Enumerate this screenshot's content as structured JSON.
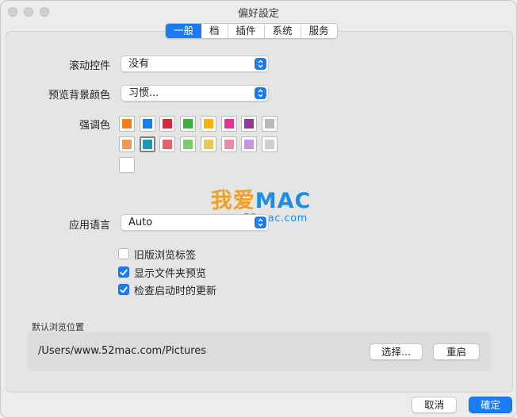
{
  "window": {
    "title": "偏好設定"
  },
  "tabs": [
    {
      "label": "一般",
      "active": true
    },
    {
      "label": "档",
      "active": false
    },
    {
      "label": "插件",
      "active": false
    },
    {
      "label": "系统",
      "active": false
    },
    {
      "label": "服务",
      "active": false
    }
  ],
  "scroll": {
    "label": "滚动控件",
    "value": "没有"
  },
  "preview_bg": {
    "label": "预览背景颜色",
    "value": "习惯..."
  },
  "accent": {
    "label": "强调色",
    "row1": [
      "#f57d0f",
      "#1a7cf3",
      "#d8283f",
      "#3faf3a",
      "#f5b50a",
      "#e8328f",
      "#8e3a96",
      "#b8b8b8"
    ],
    "row2": [
      "#ec9a55",
      "#1a9ab0",
      "#e4606e",
      "#7ccb6c",
      "#e6c85a",
      "#e88aa8",
      "#c495e2",
      "#cfcfcf"
    ],
    "row3": [
      "#ffffff"
    ],
    "selected_index": 9
  },
  "language": {
    "label": "应用语言",
    "value": "Auto"
  },
  "watermark": {
    "big_part1": "我爱",
    "big_part2": "MAC",
    "small": "www.52mac.com"
  },
  "checkboxes": [
    {
      "label": "旧版浏览标签",
      "checked": false
    },
    {
      "label": "显示文件夹预览",
      "checked": true
    },
    {
      "label": "检查启动时的更新",
      "checked": true
    }
  ],
  "default_location": {
    "label": "默认浏览位置",
    "path": "/Users/www.52mac.com/Pictures",
    "choose_label": "选择...",
    "reset_label": "重启"
  },
  "footer": {
    "cancel_label": "取消",
    "ok_label": "確定"
  },
  "colors": {
    "accent": "#1a7cf3"
  }
}
